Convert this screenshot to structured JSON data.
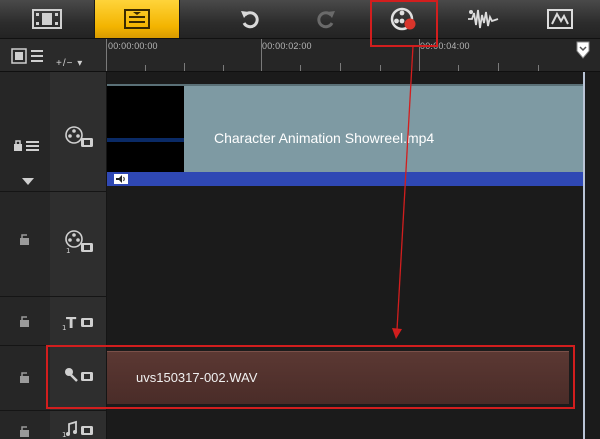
{
  "toolbar": {
    "buttons": [
      {
        "name": "storyboard-view-button",
        "icon": "film-strip-icon"
      },
      {
        "name": "timeline-view-button",
        "icon": "timeline-icon",
        "active": true
      },
      {
        "name": "undo-button",
        "icon": "undo-icon"
      },
      {
        "name": "redo-button",
        "icon": "redo-icon"
      },
      {
        "name": "sound-mixer-button",
        "icon": "sound-mixer-icon"
      },
      {
        "name": "auto-music-button",
        "icon": "waveform-icon"
      },
      {
        "name": "mix-enhance-button",
        "icon": "enhance-icon"
      }
    ]
  },
  "ruler": {
    "timecodes": [
      "00:00:00:00",
      "00:00:02:00",
      "00:00:04:00"
    ],
    "zoom_control": "+/−  ▾"
  },
  "tracks": {
    "video": {
      "clip_name": "Character Animation Showreel.mp4"
    },
    "audio": {
      "clip_name": "uvs150317-002.WAV"
    }
  },
  "colors": {
    "accent": "#f3b400",
    "video_clip": "#7e9aa3",
    "audio_clip": "#4f312c",
    "annotation": "#d21e1e"
  }
}
